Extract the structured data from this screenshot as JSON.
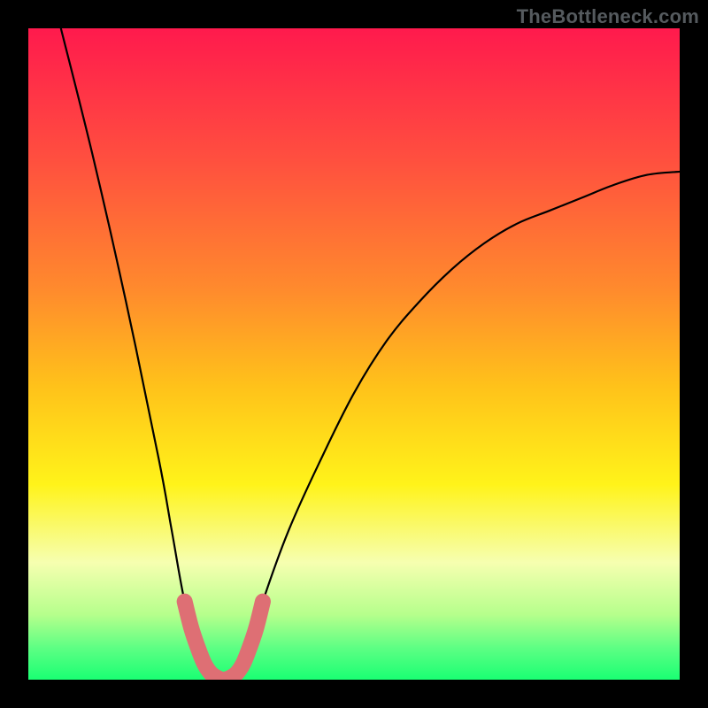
{
  "watermark": "TheBottleneck.com",
  "chart_data": {
    "type": "line",
    "title": "",
    "xlabel": "",
    "ylabel": "",
    "xlim": [
      0,
      100
    ],
    "ylim": [
      0,
      100
    ],
    "grid": false,
    "legend": false,
    "series": [
      {
        "name": "bottleneck-curve",
        "color": "#000000",
        "x": [
          5,
          10,
          15,
          20,
          22,
          24,
          26,
          28,
          30,
          32,
          34,
          36,
          40,
          45,
          50,
          55,
          60,
          65,
          70,
          75,
          80,
          85,
          90,
          95,
          100
        ],
        "y": [
          100,
          80,
          58,
          34,
          23,
          12,
          5,
          1,
          0,
          1,
          5,
          12,
          23,
          34,
          44,
          52,
          58,
          63,
          67,
          70,
          72,
          74,
          76,
          77.5,
          78
        ]
      },
      {
        "name": "bottleneck-highlight",
        "color": "#de6f74",
        "x": [
          24,
          25,
          26,
          27,
          28,
          29,
          30,
          31,
          32,
          33,
          34,
          35,
          36
        ],
        "y": [
          12,
          8,
          5,
          2.5,
          1,
          0.3,
          0,
          0.3,
          1,
          2.5,
          5,
          8,
          12
        ]
      }
    ],
    "background_gradient": {
      "stops": [
        {
          "pos": 0.0,
          "color": "#ff1a4d"
        },
        {
          "pos": 0.2,
          "color": "#ff4f3f"
        },
        {
          "pos": 0.4,
          "color": "#ff8a2d"
        },
        {
          "pos": 0.55,
          "color": "#ffc21a"
        },
        {
          "pos": 0.7,
          "color": "#fff31a"
        },
        {
          "pos": 0.82,
          "color": "#f6ffb0"
        },
        {
          "pos": 0.9,
          "color": "#b6ff8c"
        },
        {
          "pos": 0.95,
          "color": "#5fff84"
        },
        {
          "pos": 1.0,
          "color": "#1aff73"
        }
      ]
    }
  }
}
